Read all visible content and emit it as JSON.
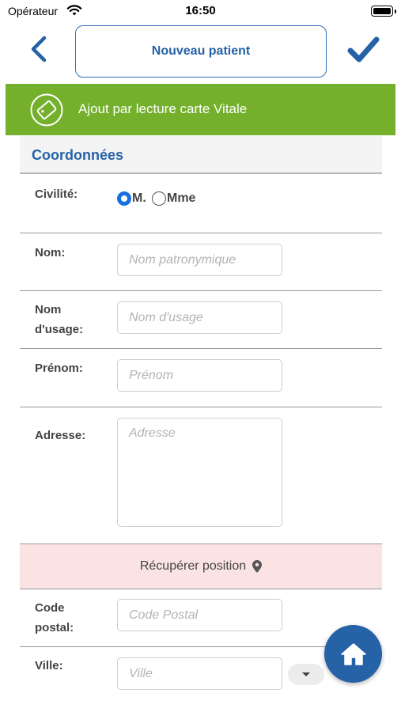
{
  "status_bar": {
    "carrier": "Opérateur",
    "time": "16:50"
  },
  "nav": {
    "title": "Nouveau patient",
    "back_icon": "chevron-left-icon",
    "confirm_icon": "checkmark-icon"
  },
  "vitale": {
    "label": "Ajout par lecture carte Vitale",
    "icon": "card-icon"
  },
  "section": {
    "title": "Coordonnées"
  },
  "form": {
    "civilite": {
      "label": "Civilité:",
      "options": [
        {
          "label": "M.",
          "selected": true
        },
        {
          "label": "Mme",
          "selected": false
        }
      ]
    },
    "nom": {
      "label": "Nom:",
      "placeholder": "Nom patronymique",
      "value": ""
    },
    "nom_usage": {
      "label_line1": "Nom",
      "label_line2": "d'usage:",
      "placeholder": "Nom d'usage",
      "value": ""
    },
    "prenom": {
      "label": "Prénom:",
      "placeholder": "Prénom",
      "value": ""
    },
    "adresse": {
      "label": "Adresse:",
      "placeholder": "Adresse",
      "value": ""
    },
    "locate": {
      "label": "Récupérer position",
      "icon": "map-pin-icon"
    },
    "code_postal": {
      "label_line1": "Code",
      "label_line2": "postal:",
      "placeholder": "Code Postal",
      "value": ""
    },
    "ville": {
      "label": "Ville:",
      "placeholder": "Ville",
      "value": ""
    }
  },
  "fab": {
    "icon": "home-icon"
  },
  "colors": {
    "primary": "#2562a6",
    "vitale_green": "#74b02c",
    "locate_bg": "#fbe3e4",
    "radio_selected": "#1a6fe0"
  }
}
